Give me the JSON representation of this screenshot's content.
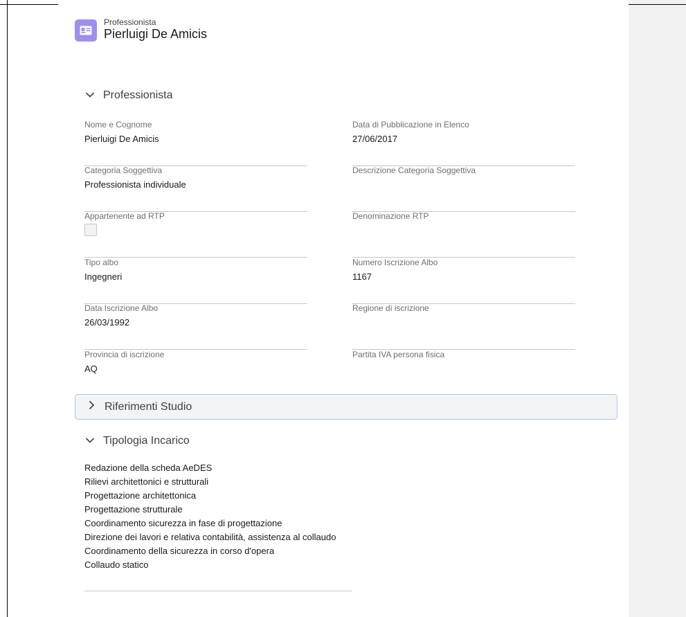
{
  "header": {
    "object_type": "Professionista",
    "record_name": "Pierluigi De Amicis",
    "icon": "contact-card-icon",
    "icon_color": "#9f8ef0"
  },
  "sections": {
    "professionista": {
      "title": "Professionista",
      "expanded": true,
      "fields": {
        "nome_cognome": {
          "label": "Nome e Cognome",
          "value": "Pierluigi De Amicis"
        },
        "data_pubblicazione": {
          "label": "Data di Pubblicazione in Elenco",
          "value": "27/06/2017"
        },
        "categoria_soggettiva": {
          "label": "Categoria Soggettiva",
          "value": "Professionista individuale"
        },
        "descrizione_categoria": {
          "label": "Descrizione Categoria Soggettiva",
          "value": ""
        },
        "appartenente_rtp": {
          "label": "Appartenente ad RTP",
          "checked": false
        },
        "denominazione_rtp": {
          "label": "Denominazione RTP",
          "value": ""
        },
        "tipo_albo": {
          "label": "Tipo albo",
          "value": "Ingegneri"
        },
        "numero_iscrizione": {
          "label": "Numero Iscrizione Albo",
          "value": "1167"
        },
        "data_iscrizione": {
          "label": "Data Iscrizione Albo",
          "value": "26/03/1992"
        },
        "regione_iscrizione": {
          "label": "Regione di iscrizione",
          "value": ""
        },
        "provincia_iscrizione": {
          "label": "Provincia di iscrizione",
          "value": "AQ"
        },
        "partita_iva": {
          "label": "Partita IVA persona fisica",
          "value": ""
        }
      }
    },
    "riferimenti_studio": {
      "title": "Riferimenti Studio",
      "expanded": false
    },
    "tipologia_incarico": {
      "title": "Tipologia Incarico",
      "expanded": true,
      "items": [
        "Redazione della scheda AeDES",
        "Rilievi architettonici e strutturali",
        "Progettazione architettonica",
        "Progettazione strutturale",
        "Coordinamento sicurezza in fase di progettazione",
        "Direzione dei lavori e relativa contabilità, assistenza al collaudo",
        "Coordinamento della sicurezza in corso d'opera",
        "Collaudo statico"
      ]
    }
  }
}
